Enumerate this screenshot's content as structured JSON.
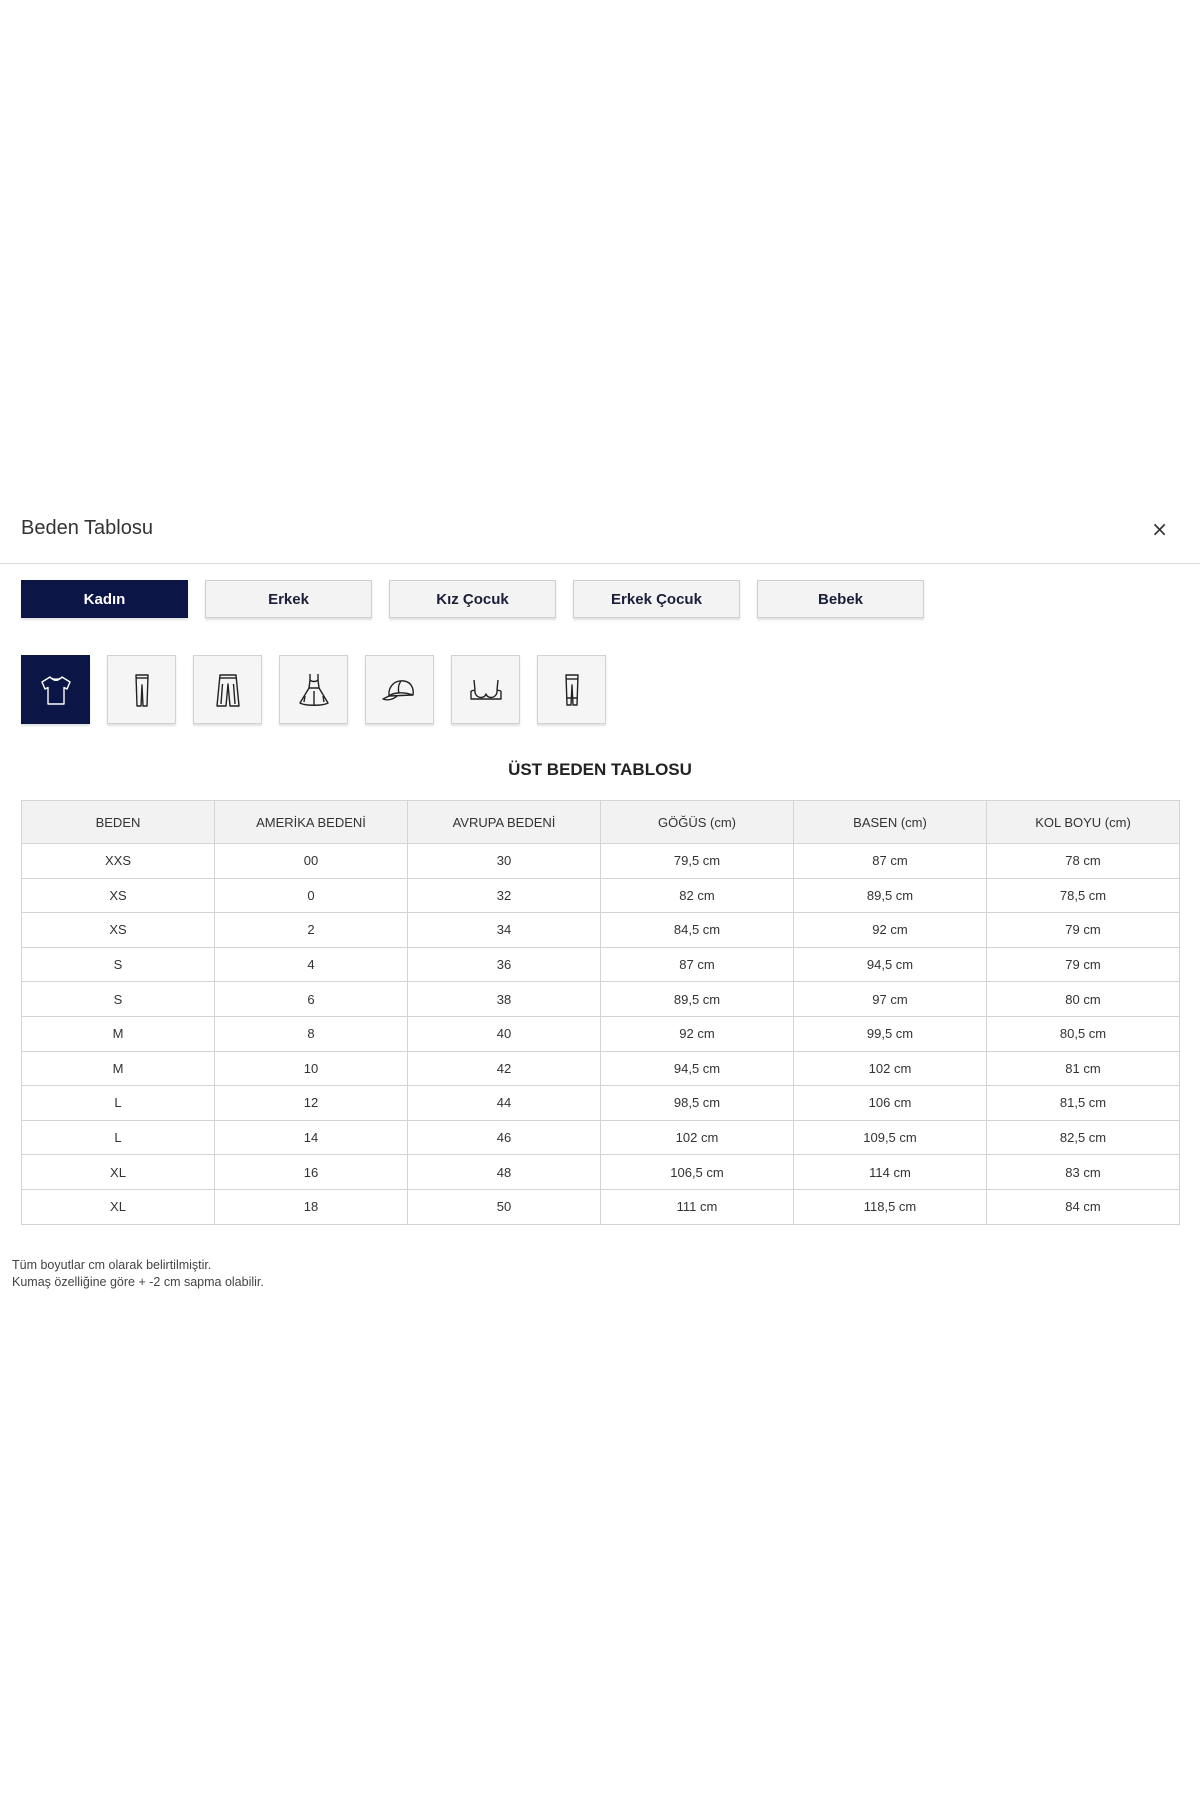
{
  "modal": {
    "title": "Beden Tablosu",
    "close_label": "×"
  },
  "category_tabs": [
    {
      "label": "Kadın",
      "active": true
    },
    {
      "label": "Erkek",
      "active": false
    },
    {
      "label": "Kız Çocuk",
      "active": false
    },
    {
      "label": "Erkek Çocuk",
      "active": false
    },
    {
      "label": "Bebek",
      "active": false
    }
  ],
  "type_tabs": [
    {
      "icon": "tshirt-icon",
      "active": true
    },
    {
      "icon": "pants-icon",
      "active": false
    },
    {
      "icon": "wide-trousers-icon",
      "active": false
    },
    {
      "icon": "dress-icon",
      "active": false
    },
    {
      "icon": "cap-icon",
      "active": false
    },
    {
      "icon": "bra-icon",
      "active": false
    },
    {
      "icon": "leggings-icon",
      "active": false
    }
  ],
  "table": {
    "title": "ÜST BEDEN TABLOSU",
    "headers": [
      "BEDEN",
      "AMERİKA BEDENİ",
      "AVRUPA BEDENİ",
      "GÖĞÜS (cm)",
      "BASEN (cm)",
      "KOL BOYU (cm)"
    ],
    "rows": [
      [
        "XXS",
        "00",
        "30",
        "79,5 cm",
        "87 cm",
        "78 cm"
      ],
      [
        "XS",
        "0",
        "32",
        "82 cm",
        "89,5 cm",
        "78,5 cm"
      ],
      [
        "XS",
        "2",
        "34",
        "84,5 cm",
        "92 cm",
        "79 cm"
      ],
      [
        "S",
        "4",
        "36",
        "87 cm",
        "94,5 cm",
        "79 cm"
      ],
      [
        "S",
        "6",
        "38",
        "89,5 cm",
        "97 cm",
        "80 cm"
      ],
      [
        "M",
        "8",
        "40",
        "92 cm",
        "99,5 cm",
        "80,5 cm"
      ],
      [
        "M",
        "10",
        "42",
        "94,5 cm",
        "102 cm",
        "81 cm"
      ],
      [
        "L",
        "12",
        "44",
        "98,5 cm",
        "106 cm",
        "81,5 cm"
      ],
      [
        "L",
        "14",
        "46",
        "102 cm",
        "109,5 cm",
        "82,5 cm"
      ],
      [
        "XL",
        "16",
        "48",
        "106,5 cm",
        "114 cm",
        "83 cm"
      ],
      [
        "XL",
        "18",
        "50",
        "111 cm",
        "118,5 cm",
        "84 cm"
      ]
    ]
  },
  "notes": [
    "Tüm boyutlar cm olarak belirtilmiştir.",
    "Kumaş özelliğine göre + -2 cm sapma olabilir."
  ],
  "colors": {
    "accent": "#0b1646",
    "tab_bg": "#f3f3f3",
    "header_bg": "#f2f2f2",
    "border": "#d4d4d4"
  }
}
